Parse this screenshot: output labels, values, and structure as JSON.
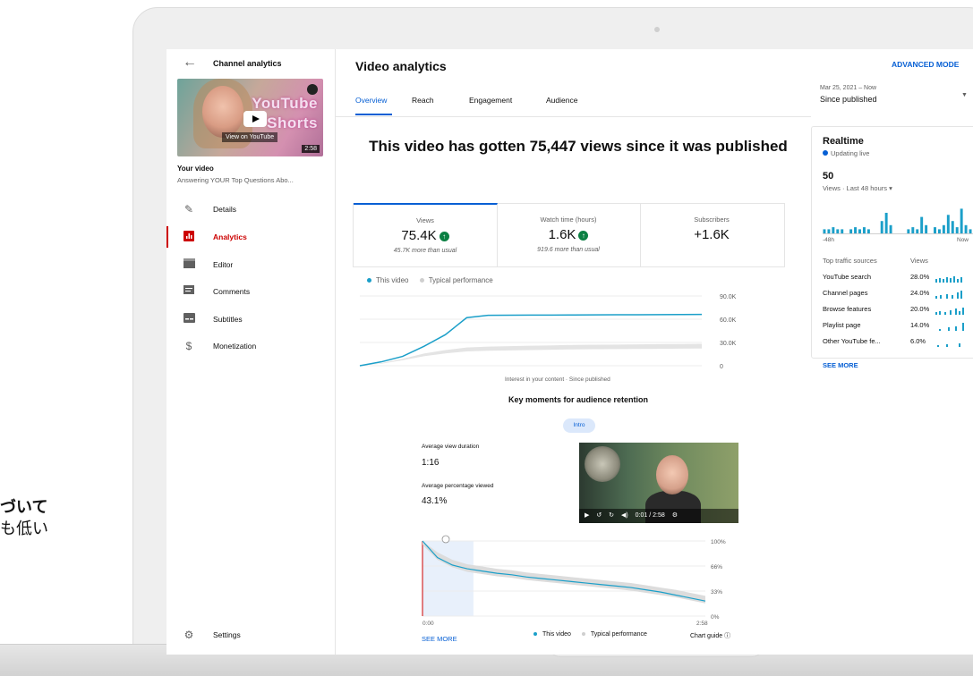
{
  "sidebar": {
    "title": "Channel analytics",
    "thumbnail": {
      "brand_line1": "YouTube",
      "brand_line2": "Shorts",
      "watch_label": "View on YouTube",
      "duration": "2:58"
    },
    "your_video": "Your video",
    "video_title": "Answering YOUR Top Questions Abo...",
    "items": [
      {
        "label": "Details",
        "icon": "pencil-icon"
      },
      {
        "label": "Analytics",
        "icon": "analytics-icon"
      },
      {
        "label": "Editor",
        "icon": "clapperboard-icon"
      },
      {
        "label": "Comments",
        "icon": "comments-icon"
      },
      {
        "label": "Subtitles",
        "icon": "subtitles-icon"
      },
      {
        "label": "Monetization",
        "icon": "dollar-icon"
      }
    ],
    "settings": "Settings"
  },
  "header": {
    "title": "Video analytics",
    "advanced_mode": "ADVANCED MODE",
    "tabs": [
      "Overview",
      "Reach",
      "Engagement",
      "Audience"
    ],
    "date_range": "Mar 25, 2021 – Now",
    "date_value": "Since published"
  },
  "background_text": {
    "line1": "づいて",
    "line2": "も低い"
  },
  "main": {
    "headline": "This video has gotten 75,447 views since it was published",
    "metrics": [
      {
        "label": "Views",
        "value": "75.4K",
        "sub": "45.7K more than usual"
      },
      {
        "label": "Watch time (hours)",
        "value": "1.6K",
        "sub": "919.6 more than usual"
      },
      {
        "label": "Subscribers",
        "value": "+1.6K",
        "sub": ""
      }
    ],
    "legend_this_video": "This video",
    "legend_typical": "Typical performance",
    "chart_caption": "Interest in your content · Since published",
    "key_moments_title": "Key moments for audience retention",
    "intro_chip": "Intro",
    "avg_view_duration_label": "Average view duration",
    "avg_view_duration": "1:16",
    "avg_pct_label": "Average percentage viewed",
    "avg_pct": "43.1%",
    "player_time": "0:01 / 2:58",
    "see_more": "SEE MORE",
    "chart_guide": "Chart guide"
  },
  "realtime": {
    "title": "Realtime",
    "live": "Updating live",
    "count": "50",
    "views_label": "Views · Last 48 hours",
    "start_label": "-48h",
    "end_label": "Now",
    "col_source": "Top traffic sources",
    "col_views": "Views",
    "sources": [
      {
        "name": "YouTube search",
        "pct": "28.0%"
      },
      {
        "name": "Channel pages",
        "pct": "24.0%"
      },
      {
        "name": "Browse features",
        "pct": "20.0%"
      },
      {
        "name": "Playlist page",
        "pct": "14.0%"
      },
      {
        "name": "Other YouTube fe...",
        "pct": "6.0%"
      }
    ],
    "see_more": "SEE MORE"
  },
  "colors": {
    "accent": "#065fd4",
    "active_nav": "#cc0000",
    "line": "#1b9fc9"
  },
  "chart_data": [
    {
      "type": "line",
      "title": "",
      "xlabel": "Interest in your content · Since published",
      "ylabel": "",
      "y_ticks": [
        "0",
        "30.0K",
        "60.0K",
        "90.0K"
      ],
      "ylim": [
        0,
        90000
      ],
      "series": [
        {
          "name": "This video",
          "values": [
            0,
            5000,
            12000,
            25000,
            40000,
            62000,
            65000,
            65200,
            65300,
            65400,
            65500,
            65600,
            65700,
            65800,
            65900,
            66000,
            66200
          ]
        },
        {
          "name": "Typical performance",
          "values": [
            0,
            3000,
            8000,
            14000,
            18000,
            21000,
            22000,
            22500,
            23000,
            23500,
            24000,
            24200,
            24400,
            24600,
            24800,
            25000,
            25200
          ]
        }
      ]
    },
    {
      "type": "line",
      "title": "Key moments for audience retention",
      "x_ticks": [
        "0:00",
        "2:58"
      ],
      "y_ticks": [
        "0%",
        "33%",
        "66%",
        "100%"
      ],
      "ylim": [
        0,
        100
      ],
      "series": [
        {
          "name": "This video",
          "values": [
            100,
            78,
            68,
            63,
            60,
            57,
            55,
            52,
            50,
            48,
            46,
            44,
            42,
            40,
            38,
            35,
            32,
            28,
            24,
            20
          ]
        },
        {
          "name": "Typical performance",
          "values": [
            100,
            80,
            70,
            64,
            61,
            58,
            56,
            53,
            51,
            49,
            47,
            45,
            43,
            41,
            39,
            36,
            33,
            30,
            26,
            22
          ]
        }
      ]
    }
  ]
}
